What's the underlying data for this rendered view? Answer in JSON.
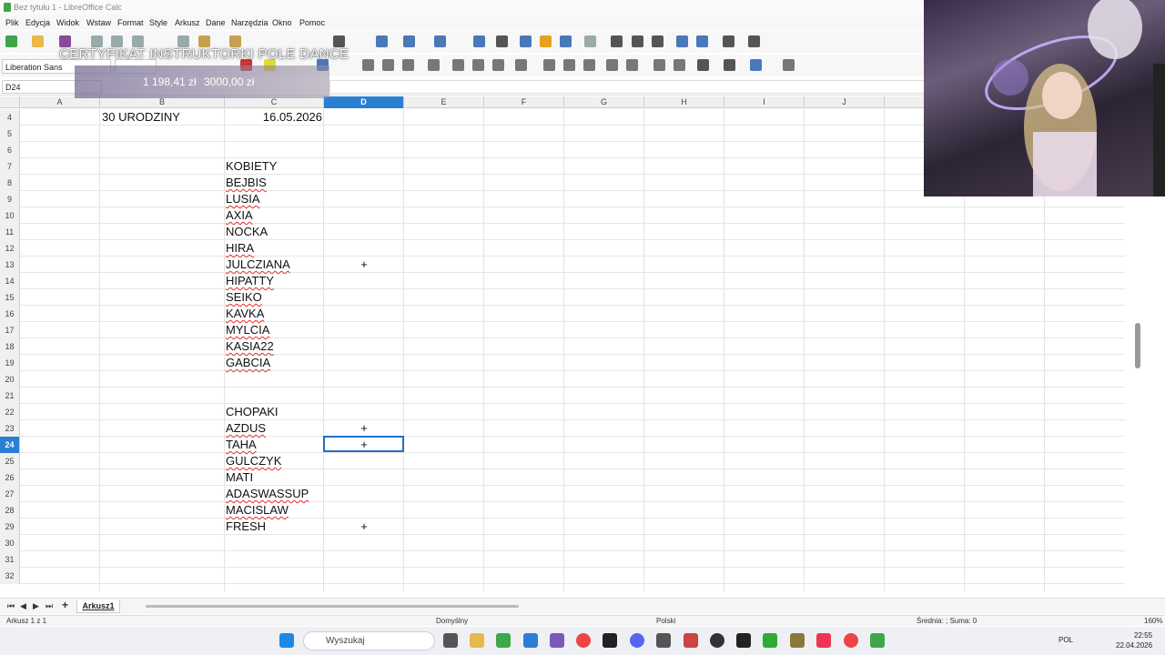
{
  "window": {
    "title": "Bez tytułu 1 - LibreOffice Calc"
  },
  "menu": [
    "Plik",
    "Edycja",
    "Widok",
    "Wstaw",
    "Format",
    "Style",
    "Arkusz",
    "Dane",
    "Narzędzia",
    "Okno",
    "Pomoc"
  ],
  "toolbar": {
    "font_name": "Liberation Sans"
  },
  "formula_bar": {
    "name_box": "D24",
    "content": ""
  },
  "columns": [
    "A",
    "B",
    "C",
    "D",
    "E",
    "F",
    "G",
    "H",
    "I",
    "J"
  ],
  "active_column": "D",
  "active_row": "24",
  "rows": [
    {
      "n": "4",
      "b": "30 URODZINY",
      "c": "16.05.2026",
      "d": ""
    },
    {
      "n": "5",
      "b": "",
      "c": "",
      "d": ""
    },
    {
      "n": "6",
      "b": "",
      "c": "",
      "d": ""
    },
    {
      "n": "7",
      "b": "",
      "c": "KOBIETY",
      "d": ""
    },
    {
      "n": "8",
      "b": "",
      "c": "BEJBIS",
      "d": ""
    },
    {
      "n": "9",
      "b": "",
      "c": "LUSIA",
      "d": ""
    },
    {
      "n": "10",
      "b": "",
      "c": "AXIA",
      "d": ""
    },
    {
      "n": "11",
      "b": "",
      "c": "NOCKA",
      "d": ""
    },
    {
      "n": "12",
      "b": "",
      "c": "HIRA",
      "d": ""
    },
    {
      "n": "13",
      "b": "",
      "c": "JULCZIANA",
      "d": "+"
    },
    {
      "n": "14",
      "b": "",
      "c": "HIPATTY",
      "d": ""
    },
    {
      "n": "15",
      "b": "",
      "c": "SEIKO",
      "d": ""
    },
    {
      "n": "16",
      "b": "",
      "c": "KAVKA",
      "d": ""
    },
    {
      "n": "17",
      "b": "",
      "c": "MYLCIA",
      "d": ""
    },
    {
      "n": "18",
      "b": "",
      "c": "KASIA22",
      "d": ""
    },
    {
      "n": "19",
      "b": "",
      "c": "GABCIA",
      "d": ""
    },
    {
      "n": "20",
      "b": "",
      "c": "",
      "d": ""
    },
    {
      "n": "21",
      "b": "",
      "c": "",
      "d": ""
    },
    {
      "n": "22",
      "b": "",
      "c": "CHOPAKI",
      "d": ""
    },
    {
      "n": "23",
      "b": "",
      "c": "AZDUS",
      "d": "+"
    },
    {
      "n": "24",
      "b": "",
      "c": "TAHA",
      "d": "+"
    },
    {
      "n": "25",
      "b": "",
      "c": "GULCZYK",
      "d": ""
    },
    {
      "n": "26",
      "b": "",
      "c": "MATI",
      "d": ""
    },
    {
      "n": "27",
      "b": "",
      "c": "ADASWASSUP",
      "d": ""
    },
    {
      "n": "28",
      "b": "",
      "c": "MACISLAW",
      "d": ""
    },
    {
      "n": "29",
      "b": "",
      "c": "FRESH",
      "d": "+"
    },
    {
      "n": "30",
      "b": "",
      "c": "",
      "d": ""
    },
    {
      "n": "31",
      "b": "",
      "c": "",
      "d": ""
    },
    {
      "n": "32",
      "b": "",
      "c": "",
      "d": ""
    }
  ],
  "sheet_tabs": [
    "Arkusz1"
  ],
  "status": {
    "sheet": "Arkusz 1 z 1",
    "style": "Domyślny",
    "language": "Polski",
    "summary": "Średnia: ; Suma: 0",
    "zoom": "160%"
  },
  "overlay": {
    "title": "CERTYFIKAT INSTRUKTORKI POLE DANCE",
    "amount": "1 198,41 zł",
    "goal": "3000,00 zł"
  },
  "taskbar": {
    "search_placeholder": "Wyszukaj",
    "language": "POL",
    "time": "22:55",
    "date": "22.04.2026"
  },
  "colors": {
    "accent": "#2a7fd4",
    "selection_border": "#1f6fc4",
    "spellcheck": "#e33333"
  }
}
